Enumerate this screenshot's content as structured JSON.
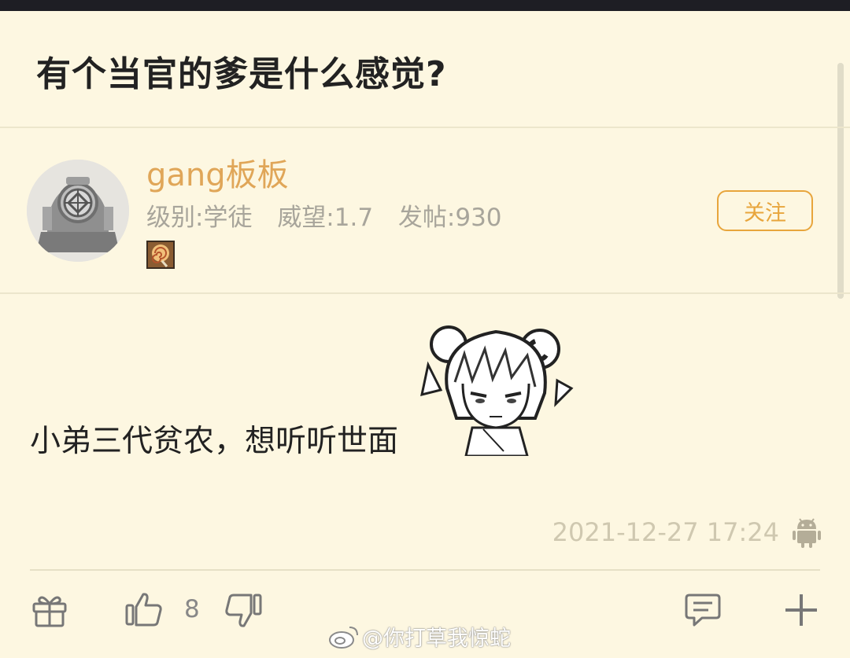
{
  "post": {
    "title": "有个当官的爹是什么感觉?",
    "body": "小弟三代贫农，想听听世面",
    "timestamp": "2021-12-27 17:24"
  },
  "author": {
    "name": "gang板板",
    "level": "级别:学徒",
    "prestige": "威望:1.7",
    "posts": "发帖:930",
    "follow_label": "关注",
    "avatar_icon": "diving-helmet-avatar",
    "badge_icon": "lollipop-badge-icon"
  },
  "toolbar": {
    "gift_icon": "gift-icon",
    "like_icon": "thumbs-up-icon",
    "like_count": "8",
    "dislike_icon": "thumbs-down-icon",
    "comment_icon": "comment-icon",
    "add_icon": "plus-icon"
  },
  "device_icon": "android-icon",
  "watermark": "@你打草我惊蛇",
  "colors": {
    "background": "#fdf7e1",
    "accent": "#e8a53c",
    "username": "#e0a658",
    "meta": "#a8a59b"
  }
}
